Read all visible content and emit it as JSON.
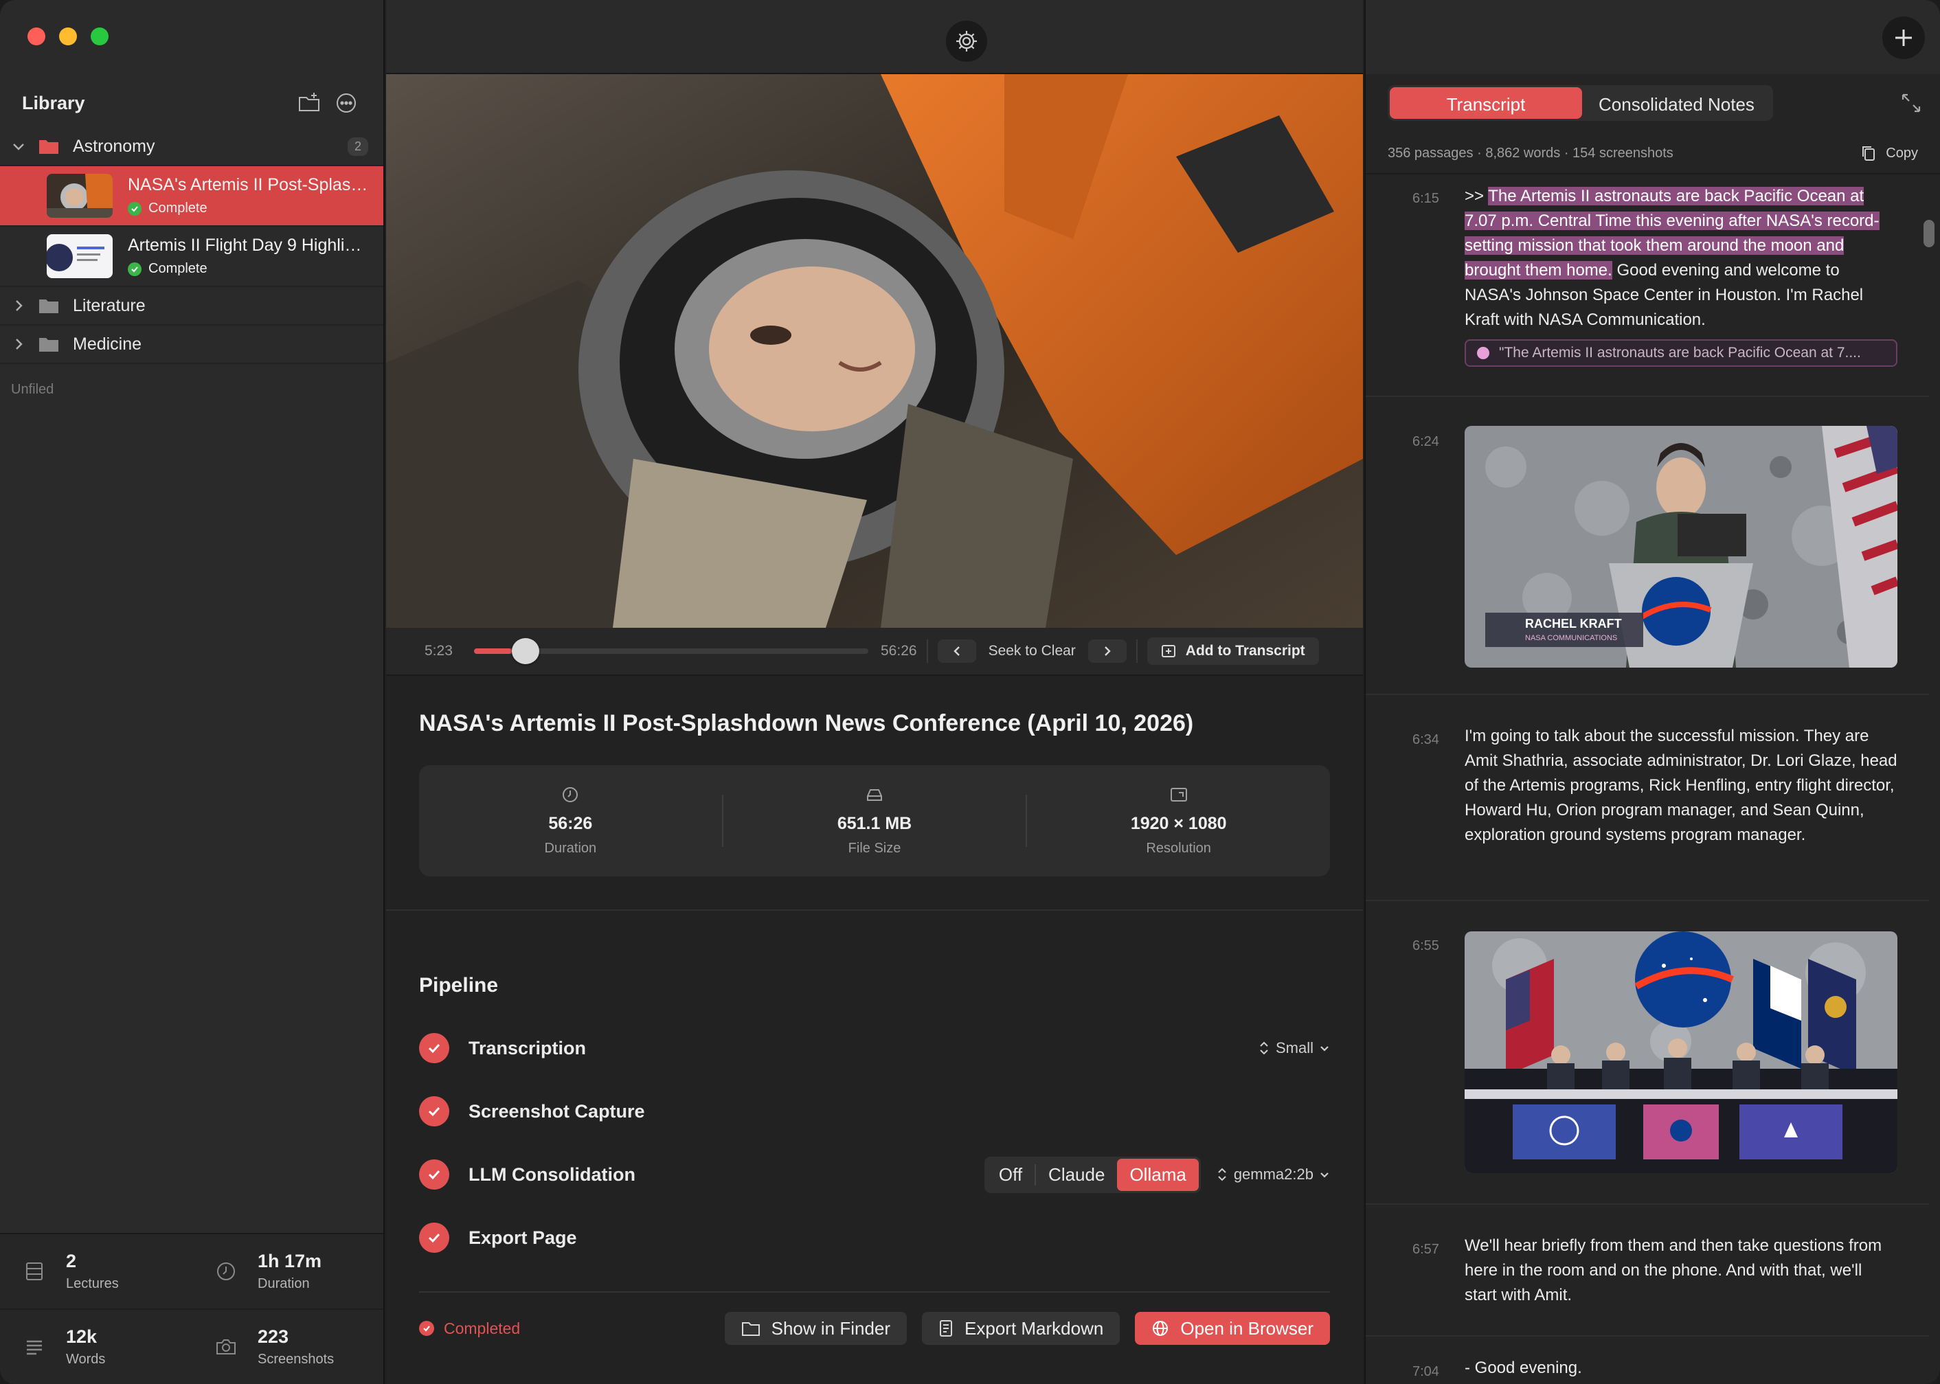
{
  "colors": {
    "accent": "#e35252",
    "highlight": "#8a4d7e",
    "complete": "#3bb54a"
  },
  "sidebar": {
    "title": "Library",
    "folders": [
      {
        "name": "Astronomy",
        "count": "2",
        "expanded": true
      },
      {
        "name": "Literature",
        "expanded": false
      },
      {
        "name": "Medicine",
        "expanded": false
      }
    ],
    "lectures": [
      {
        "title": "NASA's Artemis II Post-Splashdown News Conference (April 10, 2026)",
        "status": "Complete"
      },
      {
        "title": "Artemis II Flight Day 9 Highlights",
        "status": "Complete"
      }
    ],
    "unfiled_label": "Unfiled",
    "stats": {
      "lectures": {
        "value": "2",
        "label": "Lectures"
      },
      "duration": {
        "value": "1h 17m",
        "label": "Duration"
      },
      "words": {
        "value": "12k",
        "label": "Words"
      },
      "screenshots": {
        "value": "223",
        "label": "Screenshots"
      }
    }
  },
  "player": {
    "current_time": "5:23",
    "total_time": "56:26",
    "progress": 0.095,
    "seek_label": "Seek to Clear",
    "add_label": "Add to Transcript"
  },
  "detail": {
    "title": "NASA's Artemis II Post-Splashdown News Conference (April 10, 2026)",
    "meta": {
      "duration": {
        "value": "56:26",
        "label": "Duration"
      },
      "size": {
        "value": "651.1 MB",
        "label": "File Size"
      },
      "resolution": {
        "value": "1920 × 1080",
        "label": "Resolution"
      }
    },
    "pipeline_title": "Pipeline",
    "steps": {
      "transcription": {
        "label": "Transcription",
        "model": "Small"
      },
      "screenshot": {
        "label": "Screenshot Capture"
      },
      "llm": {
        "label": "LLM Consolidation",
        "options": [
          "Off",
          "Claude",
          "Ollama"
        ],
        "selected": "Ollama",
        "model": "gemma2:2b"
      },
      "export": {
        "label": "Export Page"
      }
    },
    "status": "Completed",
    "buttons": {
      "finder": "Show in Finder",
      "markdown": "Export Markdown",
      "browser": "Open in Browser"
    }
  },
  "transcript": {
    "tabs": [
      "Transcript",
      "Consolidated Notes"
    ],
    "summary": "356 passages · 8,862 words · 154 screenshots",
    "copy_label": "Copy",
    "entries": [
      {
        "time": "6:15",
        "prefix": ">> ",
        "highlight": "The Artemis II astronauts are back Pacific Ocean at 7.07 p.m. Central Time this evening after NASA's record-setting mission that took them around the moon and brought them home.",
        "text": " Good evening and welcome to NASA's Johnson Space Center in Houston. I'm Rachel Kraft with NASA Communication.",
        "note": "\"The Artemis II astronauts are back Pacific Ocean at 7...."
      },
      {
        "time": "6:24",
        "caption_name": "RACHEL KRAFT",
        "caption_role": "NASA COMMUNICATIONS"
      },
      {
        "time": "6:34",
        "text": "I'm going to talk about the successful mission. They are Amit Shathria, associate administrator, Dr. Lori Glaze, head of the Artemis programs, Rick Henfling, entry flight director, Howard Hu, Orion program manager, and Sean Quinn, exploration ground systems program manager."
      },
      {
        "time": "6:55"
      },
      {
        "time": "6:57",
        "text": "We'll hear briefly from them and then take questions from here in the room and on the phone. And with that, we'll start with Amit."
      },
      {
        "time": "7:04",
        "text": "- Good evening."
      }
    ]
  }
}
